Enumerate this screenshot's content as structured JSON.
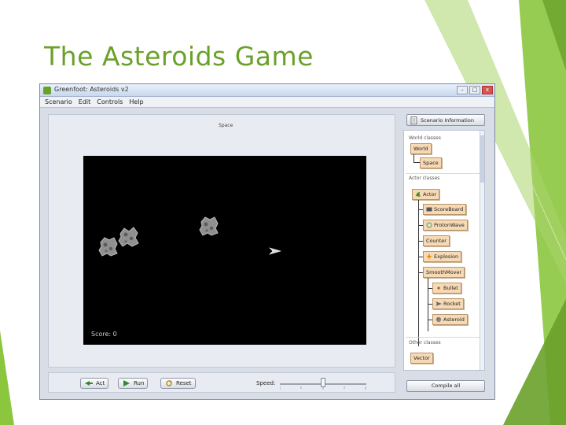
{
  "slide": {
    "title": "The Asteroids Game",
    "accent_color": "#6aa12a"
  },
  "window": {
    "title": "Greenfoot: Asteroids v2",
    "buttons": {
      "minimize": "–",
      "maximize": "□",
      "close": "x"
    }
  },
  "menu": [
    "Scenario",
    "Edit",
    "Controls",
    "Help"
  ],
  "world": {
    "caption": "Space",
    "background_color": "#000000",
    "score_text": "Score: 0",
    "asteroid_count": 3
  },
  "controls": {
    "act_label": "Act",
    "run_label": "Run",
    "reset_label": "Reset",
    "speed_label": "Speed:",
    "speed_fraction": 0.5
  },
  "side": {
    "scenario_info_label": "Scenario Information",
    "world_classes_label": "World classes",
    "world_classes": [
      "World",
      "Space"
    ],
    "actor_classes_label": "Actor classes",
    "actor_classes": [
      "Actor",
      "ScoreBoard",
      "ProtonWave",
      "Counter",
      "Explosion",
      "SmoothMover",
      "Bullet",
      "Rocket",
      "Asteroid"
    ],
    "other_classes_label": "Other classes",
    "other_classes": [
      "Vector"
    ],
    "compile_label": "Compile all"
  }
}
